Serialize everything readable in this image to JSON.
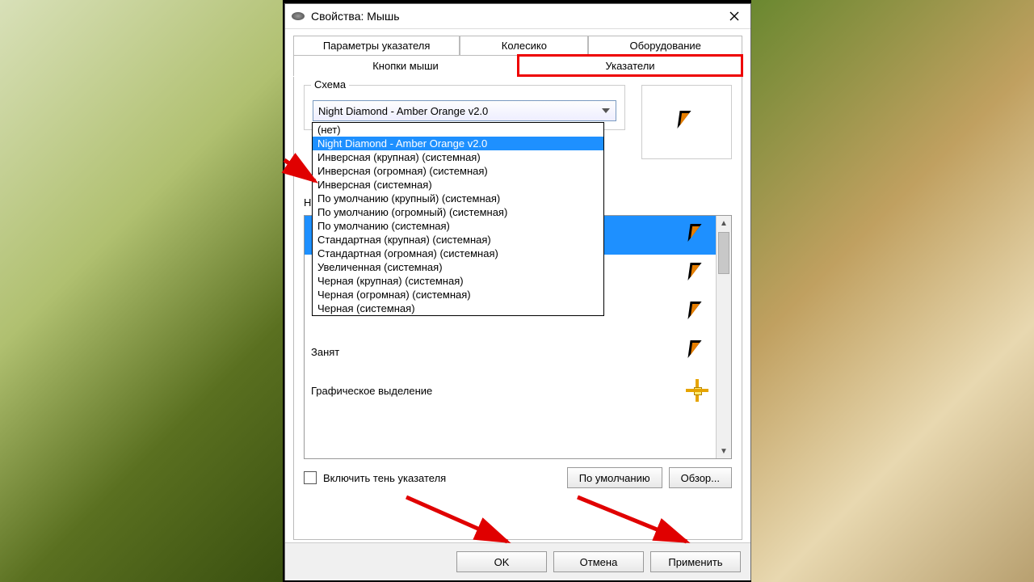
{
  "window": {
    "title": "Свойства: Мышь"
  },
  "tabs": {
    "row1": [
      "Параметры указателя",
      "Колесико",
      "Оборудование"
    ],
    "row2": [
      "Кнопки мыши",
      "Указатели"
    ],
    "active": "Указатели"
  },
  "scheme": {
    "group_label": "Схема",
    "selected": "Night Diamond - Amber Orange v2.0",
    "options": [
      "(нет)",
      "Night Diamond - Amber Orange v2.0",
      "Инверсная (крупная) (системная)",
      "Инверсная (огромная) (системная)",
      "Инверсная (системная)",
      "По умолчанию (крупный) (системная)",
      "По умолчанию (огромный) (системная)",
      "По умолчанию (системная)",
      "Стандартная (крупная) (системная)",
      "Стандартная (огромная) (системная)",
      "Увеличенная (системная)",
      "Черная (крупная) (системная)",
      "Черная (огромная) (системная)",
      "Черная (системная)"
    ],
    "highlighted_index": 1
  },
  "custom_label_prefix": "Н",
  "cursor_list": {
    "visible": [
      {
        "name": "",
        "selected": true,
        "icon": "cursor"
      },
      {
        "name": "",
        "selected": false,
        "icon": "cursor"
      },
      {
        "name": "",
        "selected": false,
        "icon": "cursor"
      },
      {
        "name": "Занят",
        "selected": false,
        "icon": "cursor"
      },
      {
        "name": "Графическое выделение",
        "selected": false,
        "icon": "precision"
      }
    ]
  },
  "checkbox": {
    "label": "Включить тень указателя",
    "checked": false
  },
  "buttons": {
    "default": "По умолчанию",
    "browse": "Обзор...",
    "ok": "OK",
    "cancel": "Отмена",
    "apply": "Применить"
  }
}
